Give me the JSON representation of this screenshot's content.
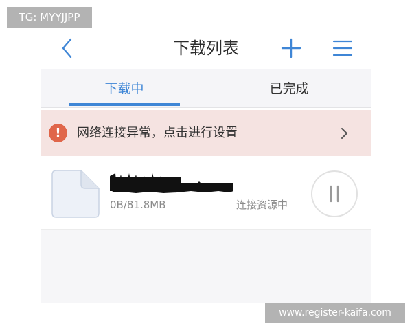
{
  "watermark_top": "TG: MYYJJPP",
  "watermark_bottom": "www.register-kaifa.com",
  "header": {
    "title": "下载列表",
    "back_icon": "chevron-left-icon",
    "add_icon": "plus-icon",
    "menu_icon": "hamburger-menu-icon"
  },
  "tabs": [
    {
      "label": "下载中",
      "active": true
    },
    {
      "label": "已完成",
      "active": false
    }
  ],
  "alert": {
    "icon": "exclamation-icon",
    "icon_glyph": "!",
    "text": "网络连接异常，点击进行设置",
    "chevron_icon": "chevron-right-icon"
  },
  "download_item": {
    "file_icon": "file-icon",
    "size_progress": "0B/81.8MB",
    "status": "连接资源中",
    "pause_icon": "pause-icon"
  },
  "colors": {
    "accent": "#3f86d6",
    "alert_bg": "#f5e3e1",
    "alert_icon": "#e0664a",
    "secondary_text": "#8a8a8a"
  }
}
